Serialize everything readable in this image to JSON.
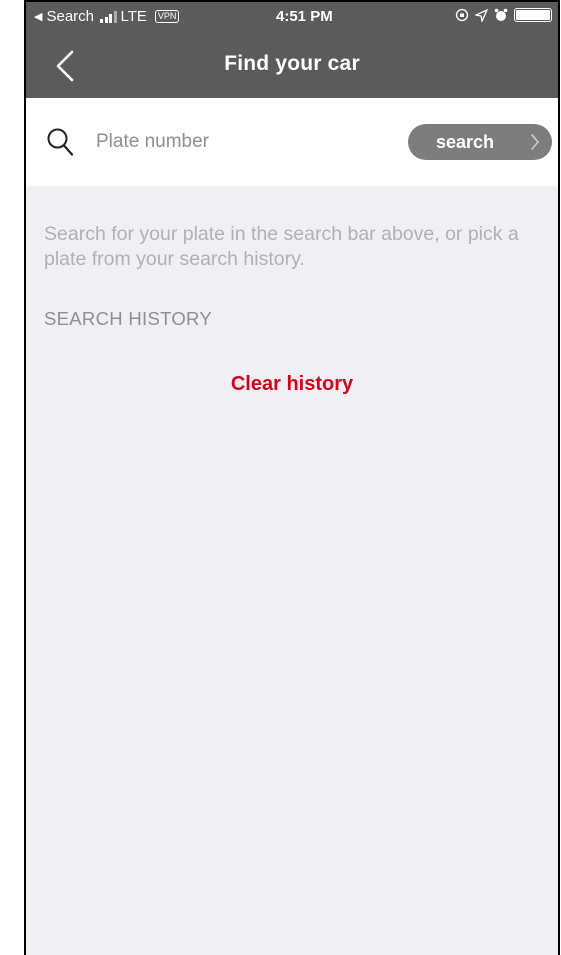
{
  "status_bar": {
    "back_app": "Search",
    "carrier": "LTE",
    "vpn": "VPN",
    "time": "4:51 PM"
  },
  "nav": {
    "title": "Find your car",
    "back_icon": "chevron-left-icon"
  },
  "search": {
    "placeholder": "Plate number",
    "value": "",
    "button_label": "search",
    "icon": "search-icon"
  },
  "hint_text": "Search for your plate in the search bar above, or pick a plate from your search history.",
  "history": {
    "header": "SEARCH HISTORY",
    "clear_label": "Clear history"
  },
  "colors": {
    "header_bg": "#5b5b5b",
    "page_bg": "#f0eff4",
    "accent_red": "#d0021b",
    "button_gray": "#7d7d7d"
  }
}
